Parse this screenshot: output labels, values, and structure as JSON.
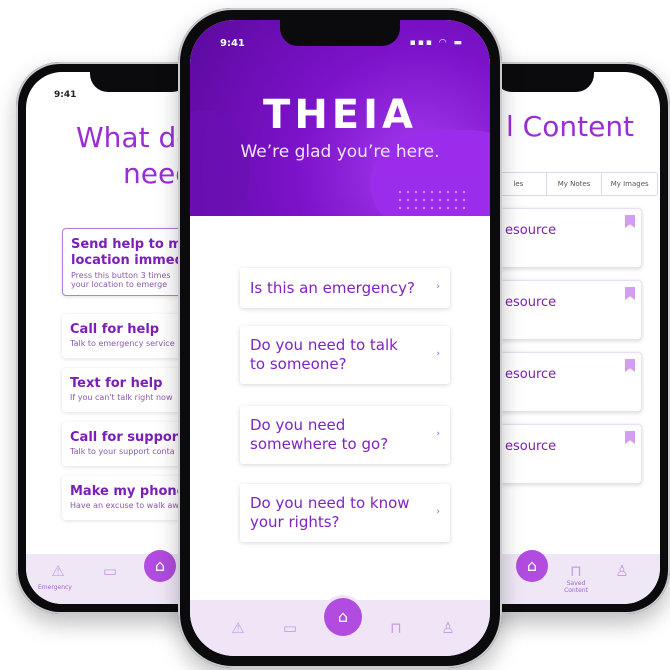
{
  "left_screen": {
    "status_time": "9:41",
    "title_line1": "What do",
    "title_line2": "need",
    "send_help": {
      "title_line1": "Send help to my",
      "title_line2": "location immed",
      "subtitle_line1": "Press this button 3 times",
      "subtitle_line2": "your location to emerge"
    },
    "options": [
      {
        "title": "Call for help",
        "subtitle": "Talk to emergency service"
      },
      {
        "title": "Text for help",
        "subtitle": "If you can't talk right now"
      },
      {
        "title": "Call for support",
        "subtitle": "Talk to your support conta"
      },
      {
        "title": "Make my phone",
        "subtitle": "Have an excuse to walk aw"
      }
    ],
    "tabbar": {
      "emergency_label": "Emergency"
    }
  },
  "right_screen": {
    "title": "l Content",
    "tabs": [
      "les",
      "My Notes",
      "My Images"
    ],
    "resources": [
      "esource",
      "esource",
      "esource",
      "esource"
    ],
    "tabbar": {
      "saved_label_line1": "Saved",
      "saved_label_line2": "Content"
    }
  },
  "center_screen": {
    "status_time": "9:41",
    "status_icons": "▪▪▪ ◠ ▬",
    "logo": "THEIA",
    "tagline": "We’re glad you’re here.",
    "questions": [
      {
        "line1": "Is this an emergency?",
        "line2": ""
      },
      {
        "line1": "Do you need to talk",
        "line2": "to someone?"
      },
      {
        "line1": "Do you need",
        "line2": "somewhere to go?"
      },
      {
        "line1": "Do you need to know",
        "line2": "your rights?"
      }
    ],
    "chevron": "›",
    "tab_icons": {
      "emergency": "⚠",
      "laptop": "▭",
      "home": "⌂",
      "bookmark": "⊓",
      "profile": "♙"
    }
  },
  "colors": {
    "accent": "#9a2ed6",
    "header_purple": "#7c12c9",
    "tabbar": "#efe5f7",
    "home_button": "#b24be0"
  }
}
